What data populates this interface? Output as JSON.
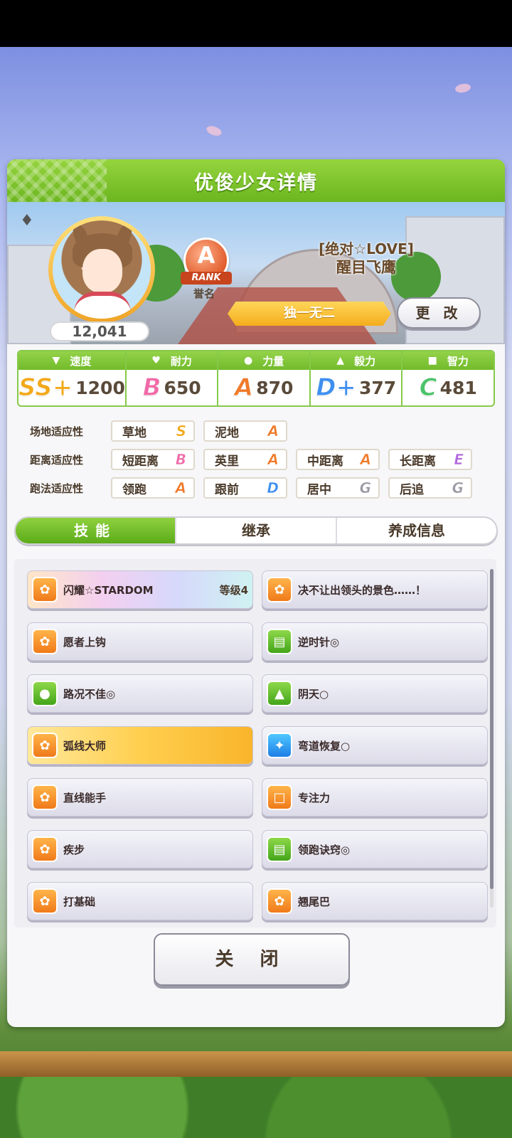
{
  "header": {
    "title": "优俊少女详情"
  },
  "profile": {
    "fans": "12,041",
    "rank_letter": "A",
    "rank_word": "RANK",
    "rank_caption": "誉名",
    "epithet": "[绝对☆LOVE]",
    "name": "醒目飞鹰",
    "title": "独一无二",
    "change_label": "更 改"
  },
  "stats": [
    {
      "label": "速度",
      "icon": "shoe-icon",
      "grade": "SS+",
      "value": "1200",
      "color": "#f2a819"
    },
    {
      "label": "耐力",
      "icon": "heart-icon",
      "grade": "B",
      "value": "650",
      "color": "#f06aa8"
    },
    {
      "label": "力量",
      "icon": "muscle-icon",
      "grade": "A",
      "value": "870",
      "color": "#f07a2a"
    },
    {
      "label": "毅力",
      "icon": "flame-icon",
      "grade": "D+",
      "value": "377",
      "color": "#3f8ff0"
    },
    {
      "label": "智力",
      "icon": "graduation-cap-icon",
      "grade": "C",
      "value": "481",
      "color": "#4cc36a"
    }
  ],
  "aptitudes": {
    "track": {
      "label": "场地适应性",
      "items": [
        {
          "name": "草地",
          "grade": "S",
          "color": "#f2a819"
        },
        {
          "name": "泥地",
          "grade": "A",
          "color": "#f07a2a"
        }
      ]
    },
    "distance": {
      "label": "距离适应性",
      "items": [
        {
          "name": "短距离",
          "grade": "B",
          "color": "#f06aa8"
        },
        {
          "name": "英里",
          "grade": "A",
          "color": "#f07a2a"
        },
        {
          "name": "中距离",
          "grade": "A",
          "color": "#f07a2a"
        },
        {
          "name": "长距离",
          "grade": "E",
          "color": "#b36ae0"
        }
      ]
    },
    "style": {
      "label": "跑法适应性",
      "items": [
        {
          "name": "领跑",
          "grade": "A",
          "color": "#f07a2a"
        },
        {
          "name": "跟前",
          "grade": "D",
          "color": "#3f8ff0"
        },
        {
          "name": "居中",
          "grade": "G",
          "color": "#9a9aa4"
        },
        {
          "name": "后追",
          "grade": "G",
          "color": "#9a9aa4"
        }
      ]
    }
  },
  "tabs": [
    "技能",
    "继承",
    "养成信息"
  ],
  "skills": [
    {
      "name": "闪耀☆STARDOM",
      "level": "等级4",
      "icon": "running-horse-icon",
      "style": "rainbow"
    },
    {
      "name": "决不让出领头的景色……！",
      "icon": "running-horse-icon",
      "style": "normal"
    },
    {
      "name": "愿者上钩",
      "icon": "running-horse-icon",
      "style": "normal"
    },
    {
      "name": "逆时针◎",
      "icon": "book-icon",
      "style": "normal"
    },
    {
      "name": "路况不佳◎",
      "icon": "muscle-icon",
      "style": "normal"
    },
    {
      "name": "阴天○",
      "icon": "flame-icon",
      "style": "normal"
    },
    {
      "name": "弧线大师",
      "icon": "running-horse-icon",
      "style": "gold"
    },
    {
      "name": "弯道恢复○",
      "icon": "sparkle-icon",
      "style": "normal"
    },
    {
      "name": "直线能手",
      "icon": "running-horse-icon",
      "style": "normal"
    },
    {
      "name": "专注力",
      "icon": "gate-icon",
      "style": "normal"
    },
    {
      "name": "疾步",
      "icon": "running-horse-icon",
      "style": "normal"
    },
    {
      "name": "领跑诀窍◎",
      "icon": "book-icon",
      "style": "normal"
    },
    {
      "name": "打基础",
      "icon": "running-horse-icon",
      "style": "normal"
    },
    {
      "name": "翘尾巴",
      "icon": "running-horse-icon",
      "style": "normal"
    }
  ],
  "close_label": "关 闭"
}
